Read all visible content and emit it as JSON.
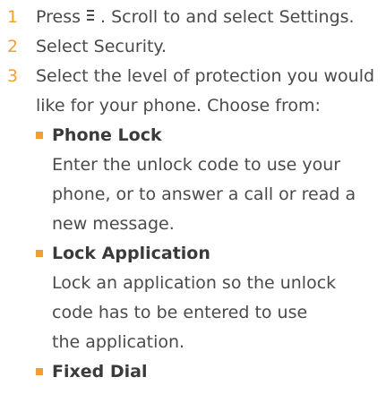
{
  "steps": [
    {
      "number": "1",
      "text_before_icon": "Press",
      "icon": "menu-icon",
      "text_after_icon": ". Scroll to and select Settings."
    },
    {
      "number": "2",
      "text": "Select Security."
    },
    {
      "number": "3",
      "text_line1": "Select the level of protection you would",
      "text_line2": "like for your phone. Choose from:"
    }
  ],
  "options": [
    {
      "title": "Phone Lock",
      "desc_lines": [
        "Enter the unlock code to use your",
        "phone, or to answer a call or read a",
        "new message."
      ]
    },
    {
      "title": "Lock Application",
      "desc_lines": [
        "Lock an application so the unlock",
        "code has to be entered to use",
        "the application."
      ]
    },
    {
      "title": "Fixed Dial"
    }
  ],
  "colors": {
    "accent": "#f0a033",
    "text": "#4a4a4a"
  }
}
